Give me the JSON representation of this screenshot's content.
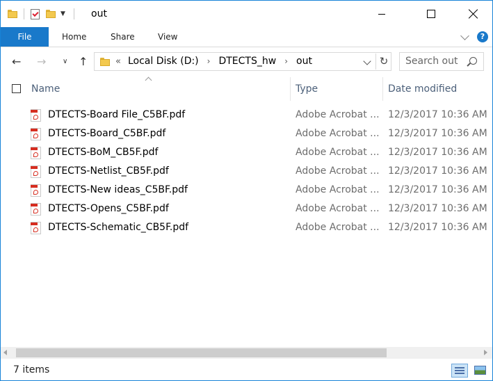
{
  "window": {
    "title": "out",
    "controls": {
      "minimize": "minimize",
      "maximize": "maximize",
      "close": "close"
    }
  },
  "ribbon": {
    "tabs": [
      {
        "label": "File",
        "active": true
      },
      {
        "label": "Home"
      },
      {
        "label": "Share"
      },
      {
        "label": "View"
      }
    ]
  },
  "address": {
    "crumbs": [
      "Local Disk (D:)",
      "DTECTS_hw",
      "out"
    ]
  },
  "search": {
    "placeholder": "Search out"
  },
  "columns": {
    "name": "Name",
    "type": "Type",
    "date": "Date modified"
  },
  "files": [
    {
      "name": "DTECTS-Board File_C5BF.pdf",
      "type": "Adobe Acrobat ...",
      "date": "12/3/2017 10:36 AM"
    },
    {
      "name": "DTECTS-Board_C5BF.pdf",
      "type": "Adobe Acrobat ...",
      "date": "12/3/2017 10:36 AM"
    },
    {
      "name": "DTECTS-BoM_CB5F.pdf",
      "type": "Adobe Acrobat ...",
      "date": "12/3/2017 10:36 AM"
    },
    {
      "name": "DTECTS-Netlist_CB5F.pdf",
      "type": "Adobe Acrobat ...",
      "date": "12/3/2017 10:36 AM"
    },
    {
      "name": "DTECTS-New ideas_C5BF.pdf",
      "type": "Adobe Acrobat ...",
      "date": "12/3/2017 10:36 AM"
    },
    {
      "name": "DTECTS-Opens_C5BF.pdf",
      "type": "Adobe Acrobat ...",
      "date": "12/3/2017 10:36 AM"
    },
    {
      "name": "DTECTS-Schematic_CB5F.pdf",
      "type": "Adobe Acrobat ...",
      "date": "12/3/2017 10:36 AM"
    }
  ],
  "status": {
    "item_count": "7 items"
  },
  "colors": {
    "accent": "#1979ca",
    "header_text": "#4c607a",
    "secondary_text": "#6d6d6d"
  }
}
